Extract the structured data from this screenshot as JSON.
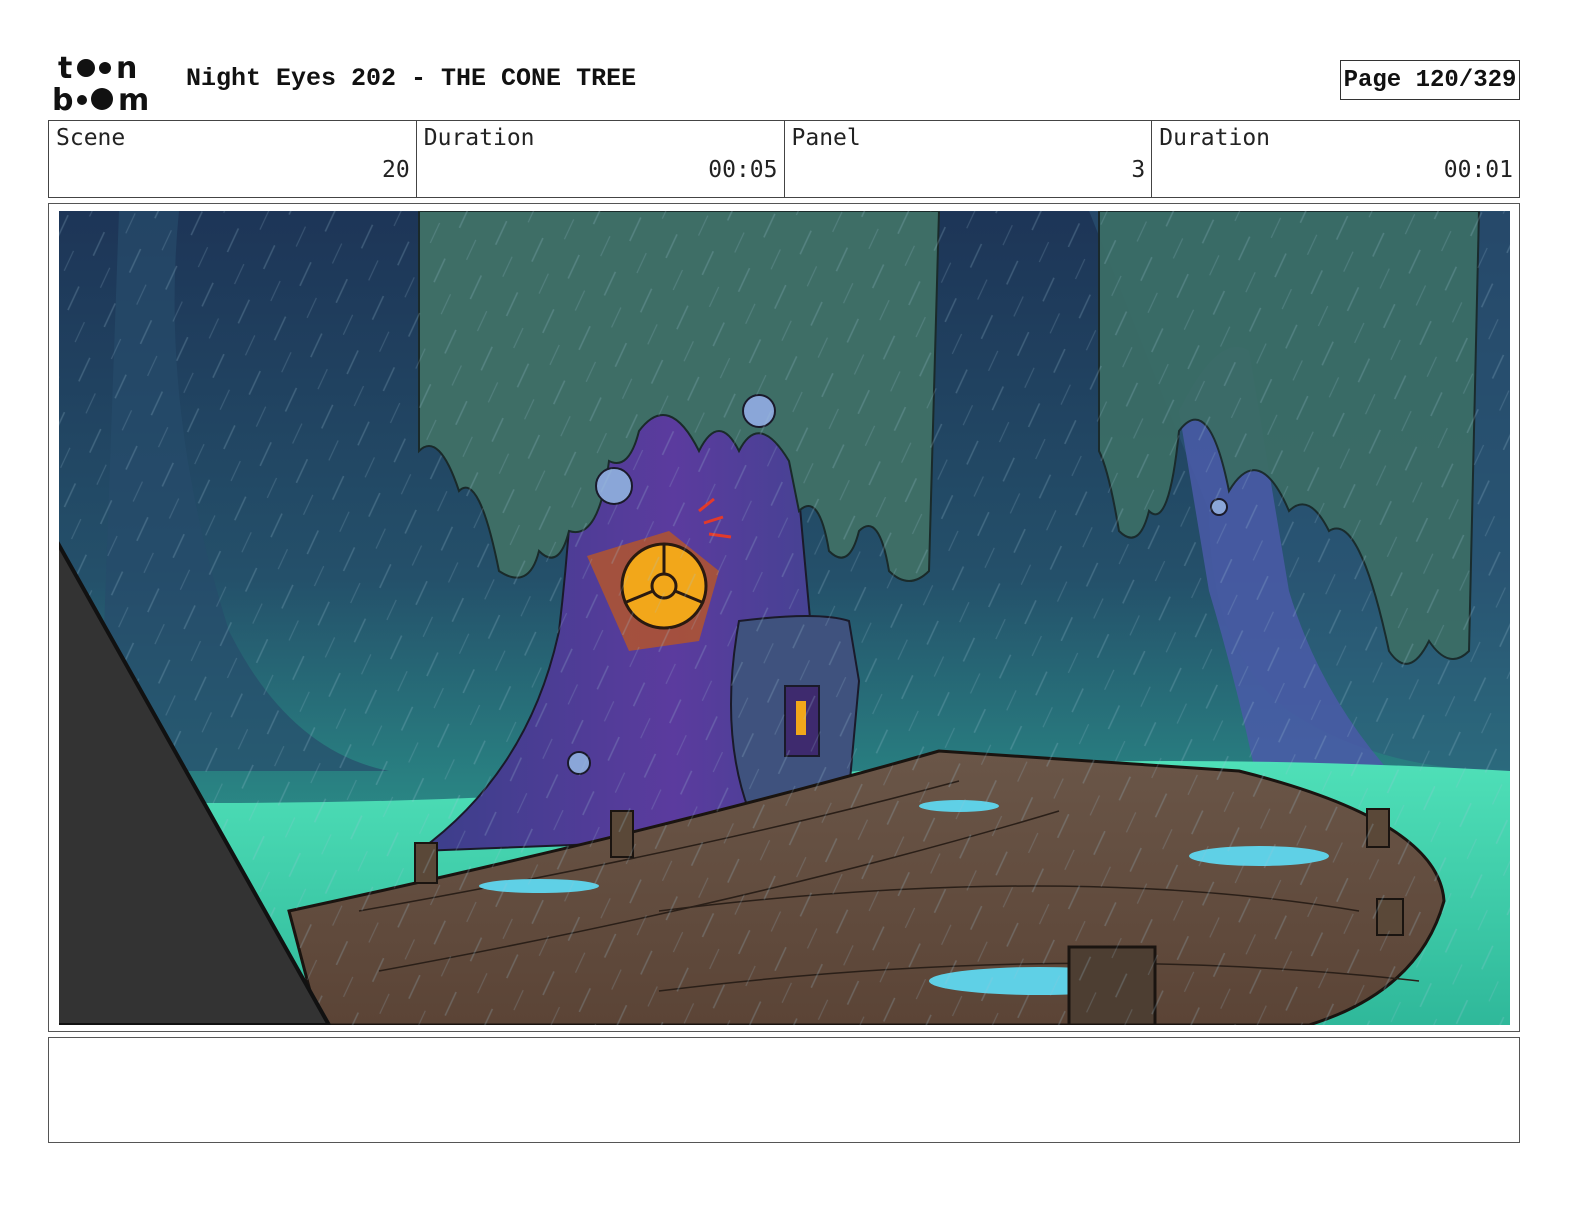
{
  "header": {
    "logo_text": "toon boom",
    "title": "Night Eyes 202 - THE CONE TREE",
    "page": "Page 120/329"
  },
  "info": {
    "scene_label": "Scene",
    "scene_value": "20",
    "scene_duration_label": "Duration",
    "scene_duration_value": "00:05",
    "panel_label": "Panel",
    "panel_value": "3",
    "panel_duration_label": "Duration",
    "panel_duration_value": "00:01"
  },
  "notes": {
    "text": ""
  },
  "colors": {
    "sky_dark": "#1f3a5c",
    "foliage": "#3d6b62",
    "trunk": "#5a3e9a",
    "glow_water": "#5ff0c4",
    "boardwalk": "#6e5547",
    "window_glow": "#f2a71a"
  }
}
